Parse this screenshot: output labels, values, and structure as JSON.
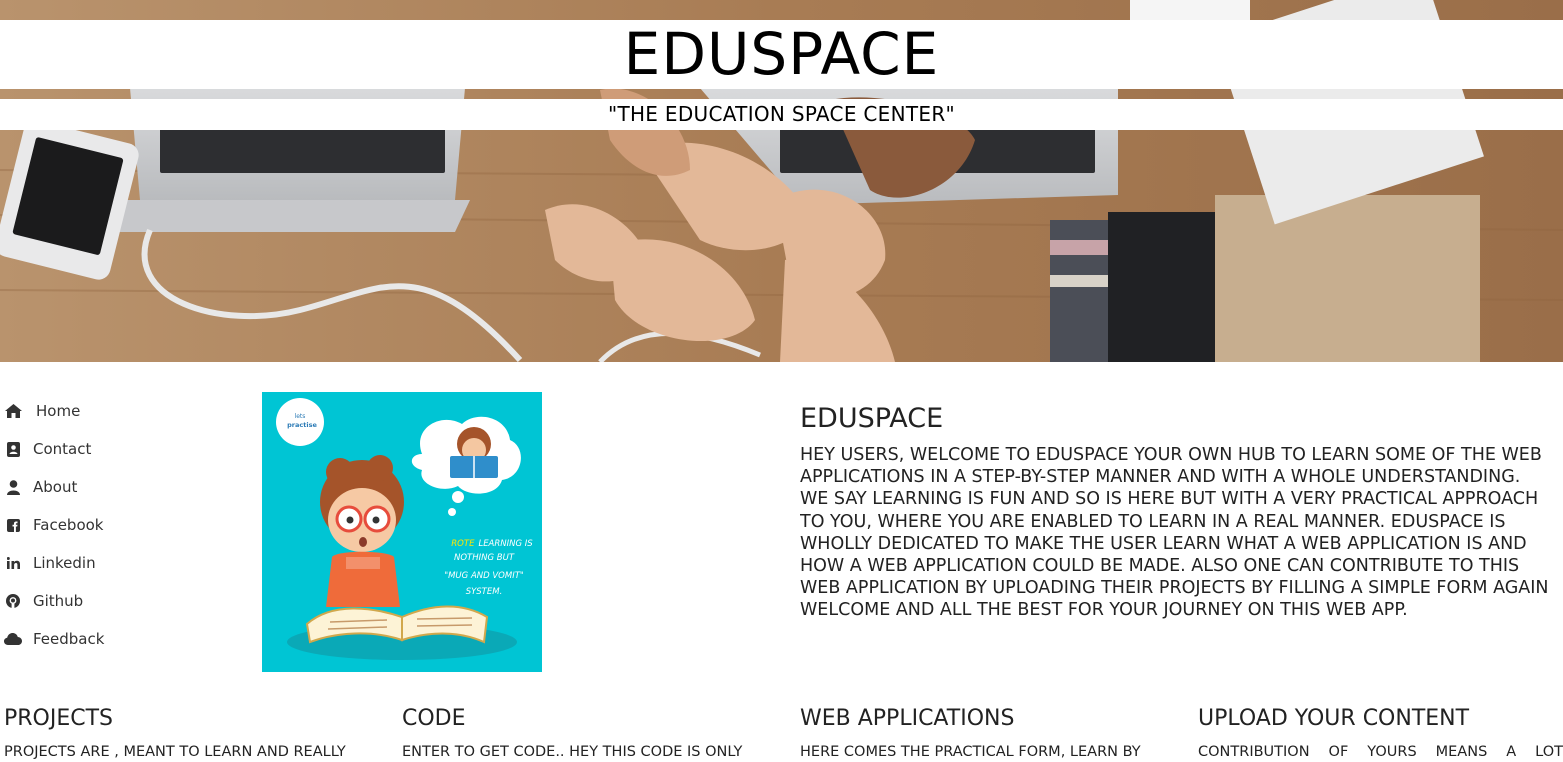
{
  "header": {
    "title": "EDUSPACE",
    "subtitle": "\"THE EDUCATION SPACE CENTER\""
  },
  "sidebar": {
    "items": [
      {
        "label": "Home",
        "icon": "home-icon"
      },
      {
        "label": "Contact",
        "icon": "contact-card-icon"
      },
      {
        "label": "About",
        "icon": "user-icon"
      },
      {
        "label": "Facebook",
        "icon": "facebook-icon"
      },
      {
        "label": "Linkedin",
        "icon": "linkedin-icon"
      },
      {
        "label": "Github",
        "icon": "github-icon"
      },
      {
        "label": "Feedback",
        "icon": "cloud-icon"
      }
    ]
  },
  "illustration": {
    "logo_top": "lets",
    "logo_bottom": "practise",
    "quote_word": "ROTE",
    "quote_rest_1": "LEARNING IS",
    "quote_rest_2": "NOTHING BUT",
    "quote_rest_3": "\"MUG AND VOMIT\"",
    "quote_rest_4": "SYSTEM."
  },
  "intro": {
    "heading": "EDUSPACE",
    "lines": [
      "HEY USERS, WELCOME TO EDUSPACE YOUR OWN HUB TO LEARN SOME OF THE WEB",
      "APPLICATIONS IN A STEP-BY-STEP MANNER AND WITH A WHOLE UNDERSTANDING.",
      "WE SAY LEARNING IS FUN AND SO IS HERE BUT WITH A VERY PRACTICAL APPROACH",
      "TO YOU, WHERE YOU ARE ENABLED TO LEARN IN A REAL MANNER. EDUSPACE IS",
      "WHOLLY DEDICATED TO MAKE THE USER LEARN WHAT A WEB APPLICATION IS AND",
      "HOW A WEB APPLICATION COULD BE MADE. ALSO ONE CAN CONTRIBUTE TO THIS",
      "WEB APPLICATION BY UPLOADING THEIR PROJECTS BY FILLING A SIMPLE FORM AGAIN",
      "WELCOME AND ALL THE BEST FOR YOUR JOURNEY ON THIS WEB APP."
    ]
  },
  "columns": [
    {
      "heading": "PROJECTS",
      "text": "PROJECTS ARE , MEANT TO LEARN AND REALLY"
    },
    {
      "heading": "CODE",
      "text": "ENTER TO GET CODE.. HEY THIS CODE IS ONLY"
    },
    {
      "heading": "WEB APPLICATIONS",
      "text": "HERE COMES THE PRACTICAL FORM, LEARN BY"
    },
    {
      "heading": "UPLOAD YOUR CONTENT",
      "text": "CONTRIBUTION OF YOURS MEANS A LOT"
    }
  ],
  "colors": {
    "illustration_bg": "#00c5d4",
    "text": "#222222",
    "band": "#ffffff"
  }
}
